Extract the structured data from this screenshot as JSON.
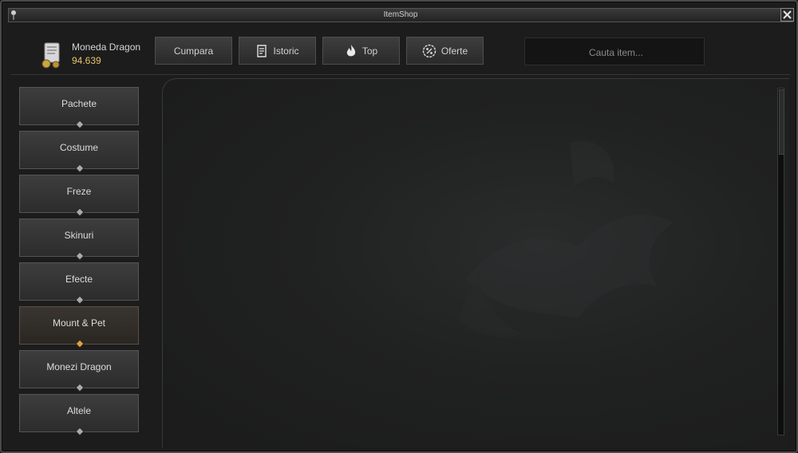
{
  "window": {
    "title": "ItemShop"
  },
  "currency": {
    "name": "Moneda Dragon",
    "value": "94.639"
  },
  "tabs": [
    {
      "label": "Cumpara",
      "icon": ""
    },
    {
      "label": "Istoric",
      "icon": "scroll-icon"
    },
    {
      "label": "Top",
      "icon": "flame-icon"
    },
    {
      "label": "Oferte",
      "icon": "percent-badge-icon"
    }
  ],
  "search": {
    "placeholder": "Cauta item..."
  },
  "categories": [
    {
      "label": "Pachete"
    },
    {
      "label": "Costume"
    },
    {
      "label": "Freze"
    },
    {
      "label": "Skinuri"
    },
    {
      "label": "Efecte"
    },
    {
      "label": "Mount & Pet",
      "active": true
    },
    {
      "label": "Monezi Dragon"
    },
    {
      "label": "Altele"
    }
  ],
  "colors": {
    "accent": "#e0a040",
    "currency_value": "#e6c36a"
  }
}
